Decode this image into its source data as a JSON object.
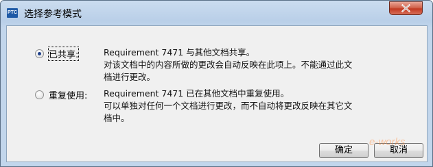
{
  "window": {
    "title": "选择参考模式",
    "app_icon_text": "PTC"
  },
  "options": [
    {
      "label": "已共享:",
      "selected": true,
      "desc": [
        "Requirement 7471 与其他文档共享。",
        "对该文档中的内容所做的更改会自动反映在此项上。不能通过此文",
        "档进行更改。"
      ]
    },
    {
      "label": "重复使用:",
      "selected": false,
      "desc": [
        "Requirement 7471 已在其他文档中重复使用。",
        "可以单独对任何一个文档进行更改，而不自动将更改反映在其它文",
        "档中。"
      ]
    }
  ],
  "buttons": {
    "ok": "确定",
    "cancel": "取消"
  },
  "watermark": "e-works"
}
